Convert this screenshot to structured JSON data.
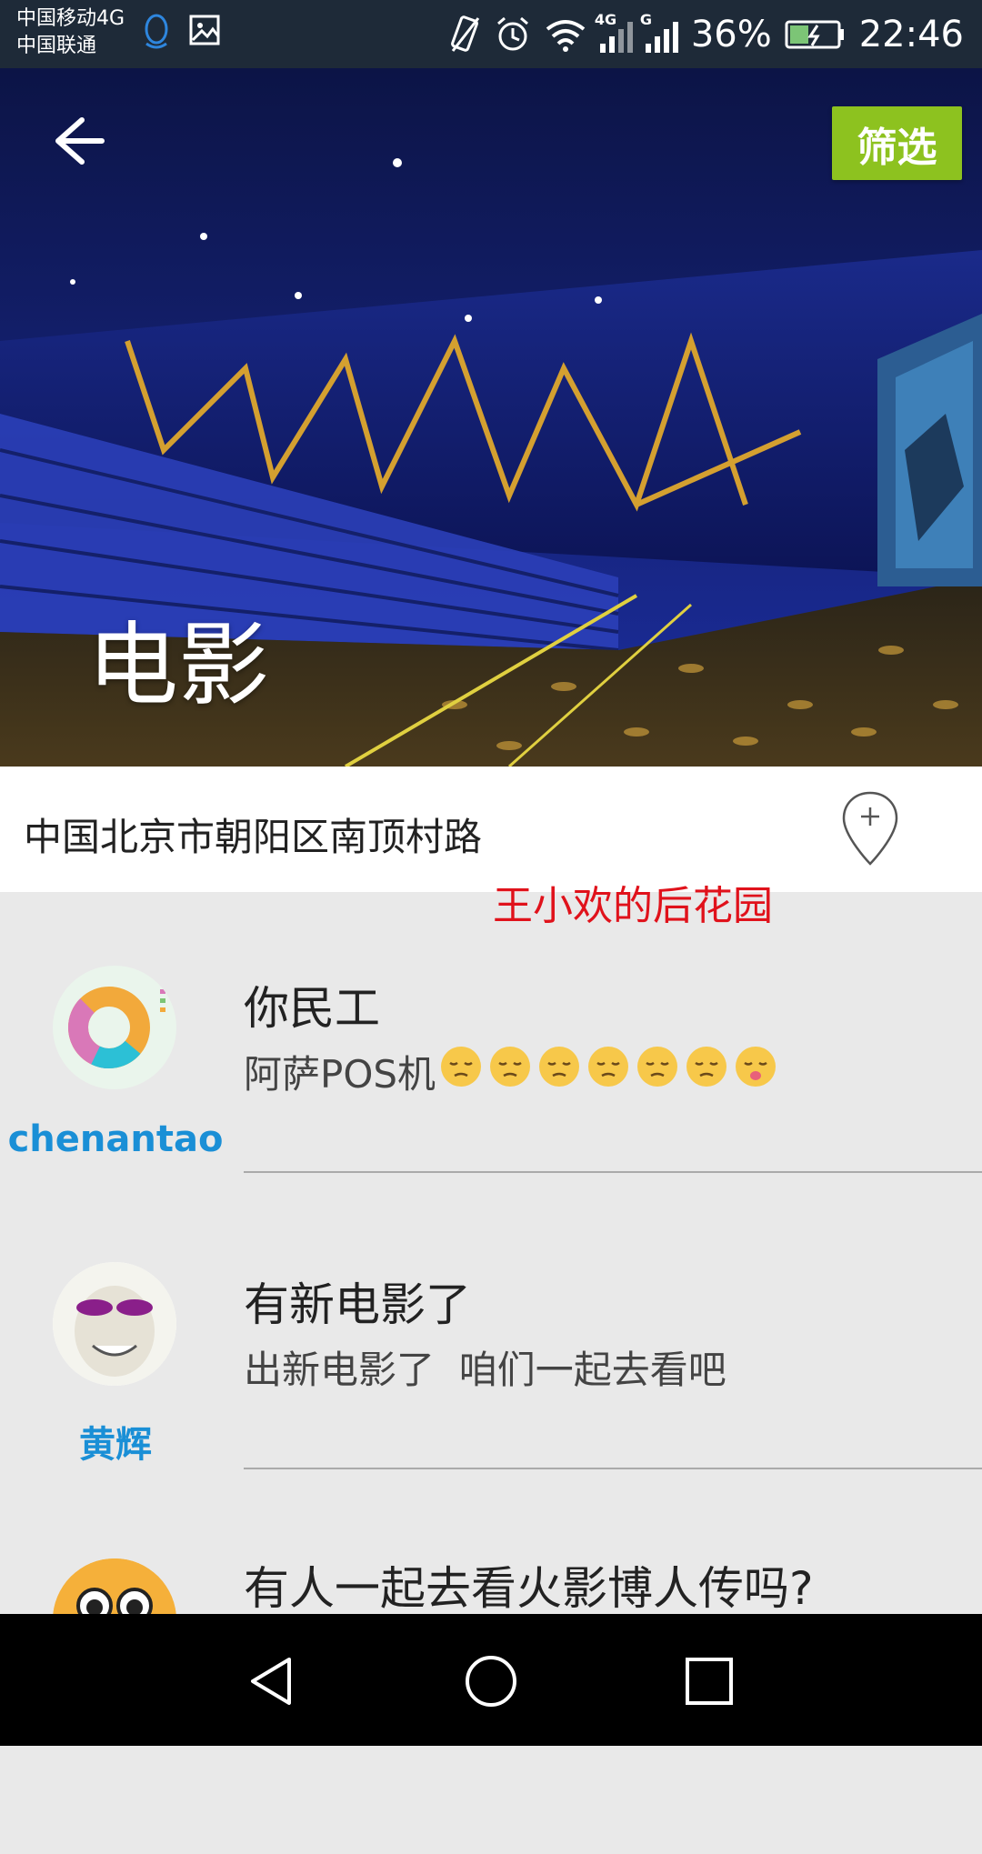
{
  "status_bar": {
    "carrier_1": "中国移动4G",
    "carrier_2": "中国联通",
    "network_1": "4G",
    "network_2": "G",
    "battery": "36%",
    "time": "22:46",
    "icons": [
      "qq-icon",
      "image-icon",
      "vibrate-icon",
      "alarm-icon",
      "wifi-icon",
      "signal-icon",
      "battery-icon"
    ]
  },
  "header": {
    "back_icon": "arrow-left-icon",
    "filter_label": "筛选",
    "title": "电影",
    "filter_color": "#8dc21f"
  },
  "location": {
    "text": "中国北京市朝阳区南顶村路",
    "icon": "location-pin-add-icon"
  },
  "watermark": "王小欢的后花园",
  "posts": [
    {
      "username": "chenantao",
      "title": "你民工",
      "body": "阿萨POS机",
      "emoji_count": 7,
      "avatar": "donut-chart-avatar"
    },
    {
      "username": "黄辉",
      "title": "有新电影了",
      "body": "出新电影了  咱们一起去看吧",
      "avatar": "face-avatar"
    },
    {
      "username": "",
      "title": "有人一起去看火影博人传吗?",
      "body": "",
      "avatar": "cartoon-face-avatar"
    }
  ],
  "nav": [
    "back-nav-icon",
    "home-nav-icon",
    "recents-nav-icon"
  ],
  "colors": {
    "link": "#1a8fd6",
    "watermark": "#e0121b"
  }
}
